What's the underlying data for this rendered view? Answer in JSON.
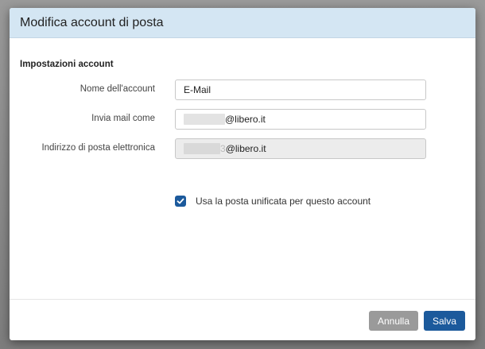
{
  "dialog": {
    "title": "Modifica account di posta"
  },
  "section": {
    "title": "Impostazioni account"
  },
  "fields": {
    "account_name": {
      "label": "Nome dell'account",
      "value": "E-Mail"
    },
    "send_as": {
      "label": "Invia mail come",
      "redacted_tail": "",
      "suffix": "@libero.it"
    },
    "email_address": {
      "label": "Indirizzo di posta elettronica",
      "redacted_tail": "3",
      "suffix": "@libero.it"
    }
  },
  "checkbox": {
    "label": "Usa la posta unificata per questo account",
    "checked": true
  },
  "buttons": {
    "cancel": "Annulla",
    "save": "Salva"
  },
  "colors": {
    "header_bg": "#d4e6f3",
    "primary": "#1c5a9c",
    "secondary": "#9a9a9a"
  }
}
